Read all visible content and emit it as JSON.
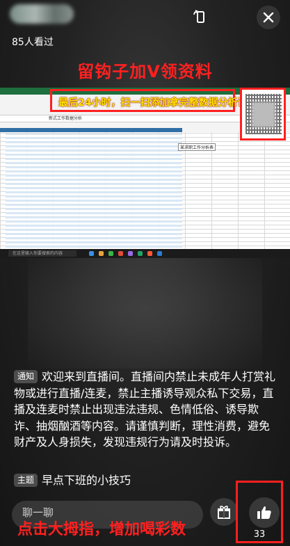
{
  "header": {
    "viewers": "85人看过",
    "promo_title": "留钩子加V领资料"
  },
  "screen": {
    "banner": "最后24小时，扫一扫添加拿完整数据分析课",
    "cell_note": "某求职工作分析表",
    "formula_text": "新式工作数据分析",
    "taskbar_search": "在这里输入你要搜索的内容"
  },
  "notice": {
    "tag": "通知",
    "text": "欢迎来到直播间。直播间内禁止未成年人打赏礼物或进行直播/连麦，禁止主播诱导观众私下交易，直播及连麦时禁止出现违法违规、色情低俗、诱导欺诈、抽烟酗酒等内容。请谨慎判断，理性消费，避免财产及人身损失，发现违规行为请及时投诉。"
  },
  "topic": {
    "tag": "主题",
    "text": "早点下班的小技巧"
  },
  "bottom": {
    "chat_placeholder": "聊一聊",
    "promo": "点击大拇指，增加喝彩数",
    "like_count": "33"
  },
  "colors": {
    "promo_red": "#ff2020",
    "banner_yellow": "#ffe600",
    "highlight_border": "#ff1f1f"
  },
  "icons": [
    "close-icon",
    "rotate-screen-icon",
    "gift-icon",
    "thumbs-up-icon"
  ]
}
